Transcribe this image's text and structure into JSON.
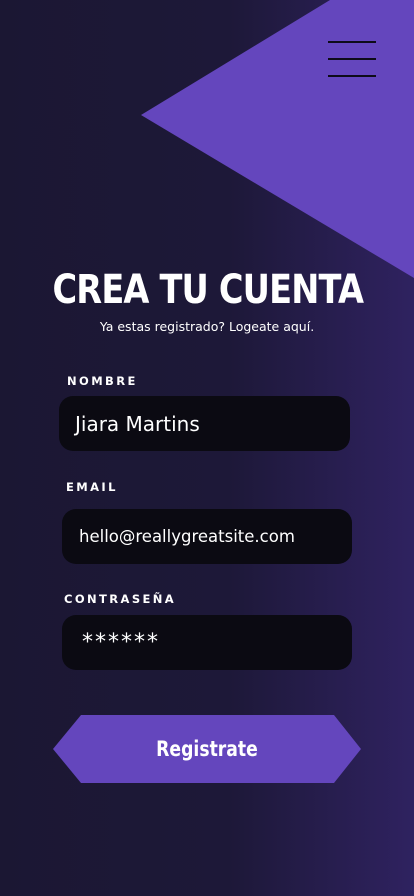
{
  "accent_color": "#6446bd",
  "background_color": "#1b1733",
  "menu": {
    "icon": "hamburger-menu-icon"
  },
  "header": {
    "title": "CREA TU CUENTA",
    "subtitle": "Ya estas registrado? Logeate aquí."
  },
  "form": {
    "name_label": "NOMBRE",
    "name_value": "Jiara Martins",
    "email_label": "EMAIL",
    "email_value": "hello@reallygreatsite.com",
    "password_label": "CONTRASEÑA",
    "password_value": "******"
  },
  "submit_label": "Registrate"
}
